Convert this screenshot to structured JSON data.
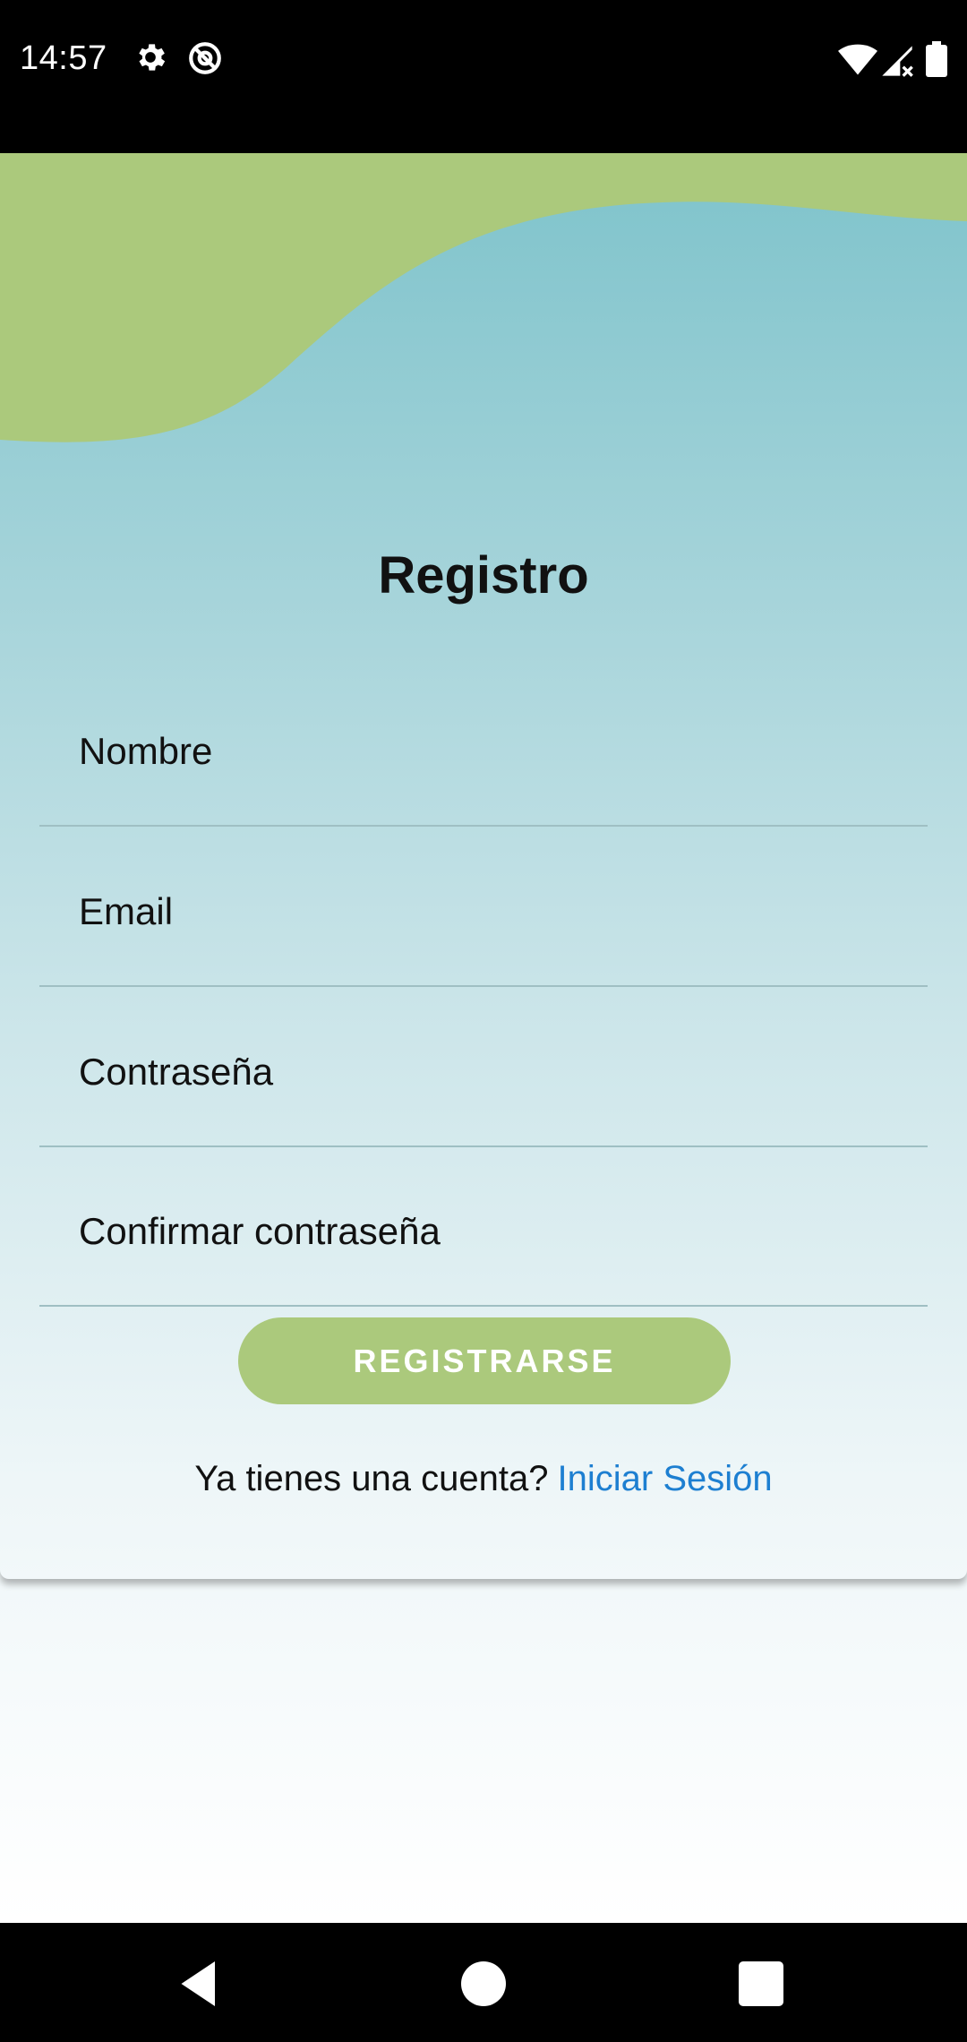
{
  "status_bar": {
    "time": "14:57",
    "icons": [
      "settings-gear-icon",
      "data-saver-icon",
      "wifi-icon",
      "cell-signal-icon",
      "battery-icon"
    ]
  },
  "colors": {
    "wave_green": "#abc97c",
    "gradient_top": "#7ec3cb",
    "link_blue": "#1d7fd1"
  },
  "form": {
    "title": "Registro",
    "fields": [
      {
        "name": "nombre",
        "placeholder": "Nombre",
        "value": ""
      },
      {
        "name": "email",
        "placeholder": "Email",
        "value": ""
      },
      {
        "name": "password",
        "placeholder": "Contraseña",
        "value": ""
      },
      {
        "name": "confirm-password",
        "placeholder": "Confirmar contraseña",
        "value": ""
      }
    ],
    "submit_label": "REGISTRARSE",
    "login_prompt": "Ya tienes una cuenta?",
    "login_link": "Iniciar Sesión"
  },
  "nav_bar": {
    "buttons": [
      "back-icon",
      "home-icon",
      "recents-icon"
    ]
  }
}
